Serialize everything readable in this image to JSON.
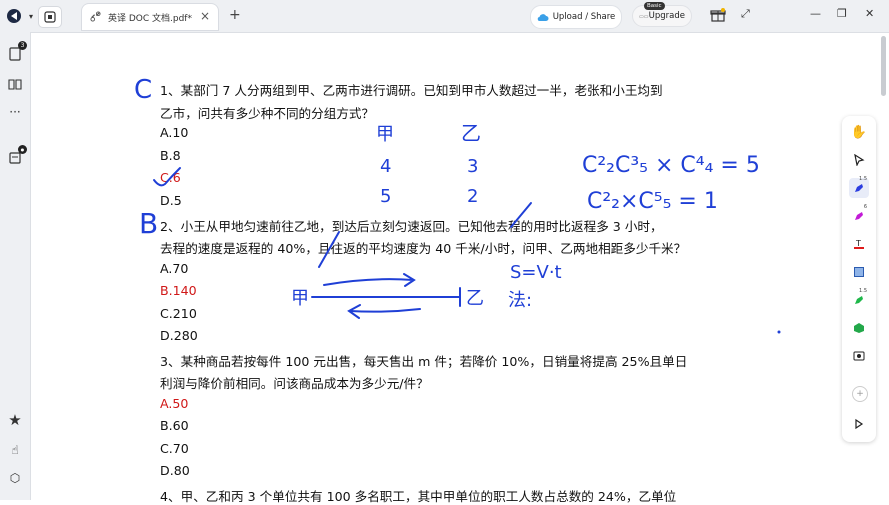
{
  "topbar": {
    "tab_title": "英译 DOC 文档.pdf*",
    "upload_label": "Upload / Share",
    "upgrade_label": "Upgrade",
    "upgrade_badge": "Basic",
    "close_glyph": "×",
    "add_tab_glyph": "+"
  },
  "leftbar": {
    "pages_badge": "3",
    "comments_badge": "●"
  },
  "document": {
    "q1_line1": "1、某部门 7 人分两组到甲、乙两市进行调研。已知到甲市人数超过一半，老张和小王均到",
    "q1_line2": "乙市，问共有多少种不同的分组方式？",
    "q1_options": [
      "A.10",
      "B.8",
      "C.6",
      "D.5"
    ],
    "q2_line1": "2、小王从甲地匀速前往乙地，到达后立刻匀速返回。已知他去程的用时比返程多 3 小时，",
    "q2_line2": "去程的速度是返程的 40%，且往返的平均速度为 40 千米/小时，问甲、乙两地相距多少千米？",
    "q2_options": [
      "A.70",
      "B.140",
      "C.210",
      "D.280"
    ],
    "q3_line1": "3、某种商品若按每件 100 元出售，每天售出 m 件；若降价 10%，日销量将提高 25%且单日",
    "q3_line2": "利润与降价前相同。问该商品成本为多少元/件？",
    "q3_options": [
      "A.50",
      "B.60",
      "C.70",
      "D.80"
    ],
    "q4_line1": "4、甲、乙和丙 3 个单位共有 100 多名职工，其中甲单位的职工人数占总数的 24%，乙单位"
  },
  "annotations": {
    "q1_mark": "C",
    "q2_mark": "B",
    "jia": "甲",
    "yi": "乙",
    "row1_left": "4",
    "row1_right": "3",
    "row2_left": "5",
    "row2_right": "2",
    "formula1": "C²₂C³₅ × C⁴₄ = 5",
    "formula2": "C²₂×C⁵₅ = 1",
    "svt": "S=V·t",
    "fa": "法:",
    "route_jia": "甲",
    "route_yi": "乙"
  },
  "rightbar": {
    "pen1_size": "1.5",
    "pen2_size": "6",
    "pen3_size": "1.5"
  },
  "colors": {
    "ink_blue": "#1f3fd6",
    "answer_red": "#d01818",
    "pen_blue": "#2b3de0",
    "pen_magenta": "#c21bd6",
    "pen_green": "#1fb84a"
  }
}
